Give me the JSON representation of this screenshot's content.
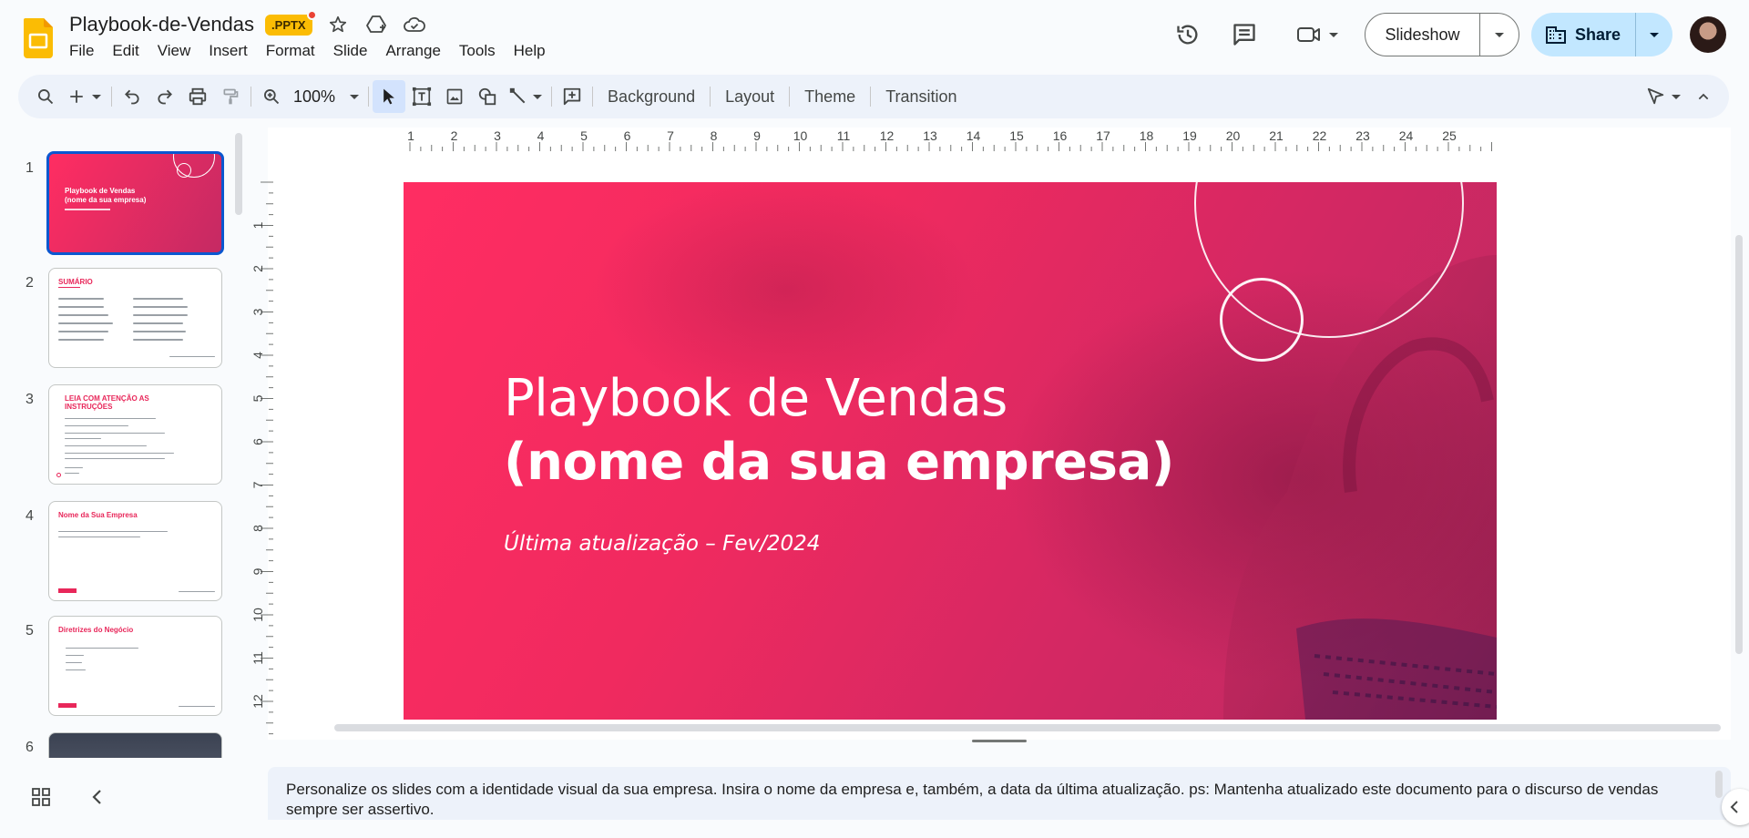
{
  "app": {
    "doc_title": "Playbook-de-Vendas",
    "file_badge": ".PPTX",
    "brand_color": "#fbbc04",
    "accent": "#0b57d0"
  },
  "menu": [
    "File",
    "Edit",
    "View",
    "Insert",
    "Format",
    "Slide",
    "Arrange",
    "Tools",
    "Help"
  ],
  "header_actions": {
    "slideshow_label": "Slideshow",
    "share_label": "Share",
    "icons": [
      "history-icon",
      "comments-icon",
      "meet-icon"
    ]
  },
  "toolbar": {
    "zoom": "100%",
    "background_label": "Background",
    "layout_label": "Layout",
    "theme_label": "Theme",
    "transition_label": "Transition"
  },
  "filmstrip": {
    "slides": [
      {
        "num": "1",
        "title": "Playbook de Vendas (nome da sua empresa)",
        "active": true
      },
      {
        "num": "2",
        "title": "SUMÁRIO"
      },
      {
        "num": "3",
        "title": "LEIA COM ATENÇÃO AS INSTRUÇÕES"
      },
      {
        "num": "4",
        "title": "Nome da Sua Empresa"
      },
      {
        "num": "5",
        "title": "Diretrizes do Negócio"
      },
      {
        "num": "6",
        "title": ""
      }
    ]
  },
  "ruler": {
    "h_labels": [
      "1",
      "2",
      "3",
      "4",
      "5",
      "6",
      "7",
      "8",
      "9",
      "10",
      "11",
      "12",
      "13",
      "14",
      "15",
      "16",
      "17",
      "18",
      "19",
      "20",
      "21",
      "22",
      "23",
      "24",
      "25"
    ],
    "v_labels": [
      "1",
      "2",
      "3",
      "4",
      "5",
      "6",
      "7",
      "8",
      "9",
      "10",
      "11",
      "12"
    ]
  },
  "slide": {
    "title_line1": "Playbook de Vendas",
    "title_line2": "(nome da sua empresa)",
    "subtitle": "Última atualização – Fev/2024",
    "bg_color": "#f42c60"
  },
  "speaker_notes": "Personalize os slides com a identidade visual da sua empresa. Insira o nome da empresa e, também, a data da última atualização. ps: Mantenha atualizado este documento para o discurso de vendas sempre ser assertivo."
}
